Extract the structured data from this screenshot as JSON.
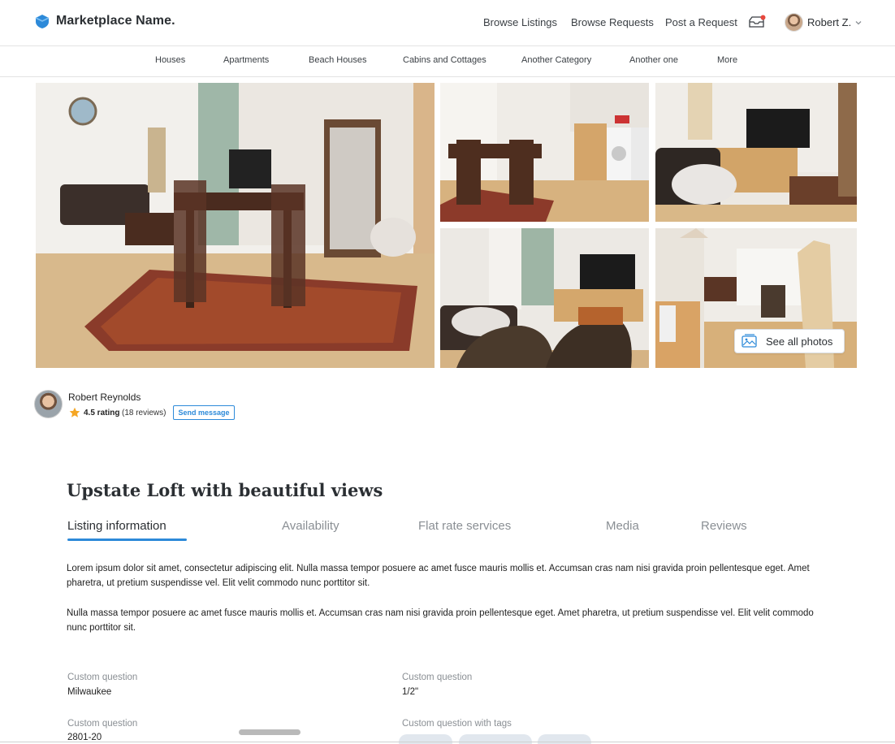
{
  "header": {
    "brand": "Marketplace Name.",
    "nav": [
      "Browse Listings",
      "Browse Requests",
      "Post a Request"
    ],
    "user_name": "Robert Z.",
    "accent_color": "#2d8ad9",
    "notification_color": "#e8473d"
  },
  "categories": [
    "Houses",
    "Apartments",
    "Beach Houses",
    "Cabins and Cottages",
    "Another Category",
    "Another one",
    "More"
  ],
  "gallery": {
    "see_all_label": "See all photos"
  },
  "host": {
    "name": "Robert Reynolds",
    "rating": "4.5 rating",
    "reviews": "(18 reviews)",
    "send_message": "Send message"
  },
  "listing": {
    "title": "Upstate Loft with beautiful views",
    "tabs": [
      "Listing information",
      "Availability",
      "Flat rate services",
      "Media",
      "Reviews"
    ],
    "active_tab": "Listing information",
    "paragraphs": [
      "Lorem ipsum dolor sit amet, consectetur adipiscing elit. Nulla massa tempor posuere ac amet fusce mauris mollis et. Accumsan cras nam nisi gravida proin pellentesque eget. Amet pharetra, ut pretium suspendisse vel. Elit velit commodo nunc porttitor sit.",
      "Nulla massa tempor posuere ac amet fusce mauris mollis et. Accumsan cras nam nisi gravida proin pellentesque eget. Amet pharetra, ut pretium suspendisse vel. Elit velit commodo nunc porttitor sit."
    ],
    "questions": [
      {
        "label": "Custom question",
        "value": "Milwaukee"
      },
      {
        "label": "Custom question",
        "value": "1/2\""
      },
      {
        "label": "Custom question",
        "value": "2801-20"
      },
      {
        "label": "Custom question with tags",
        "value": ""
      }
    ]
  }
}
